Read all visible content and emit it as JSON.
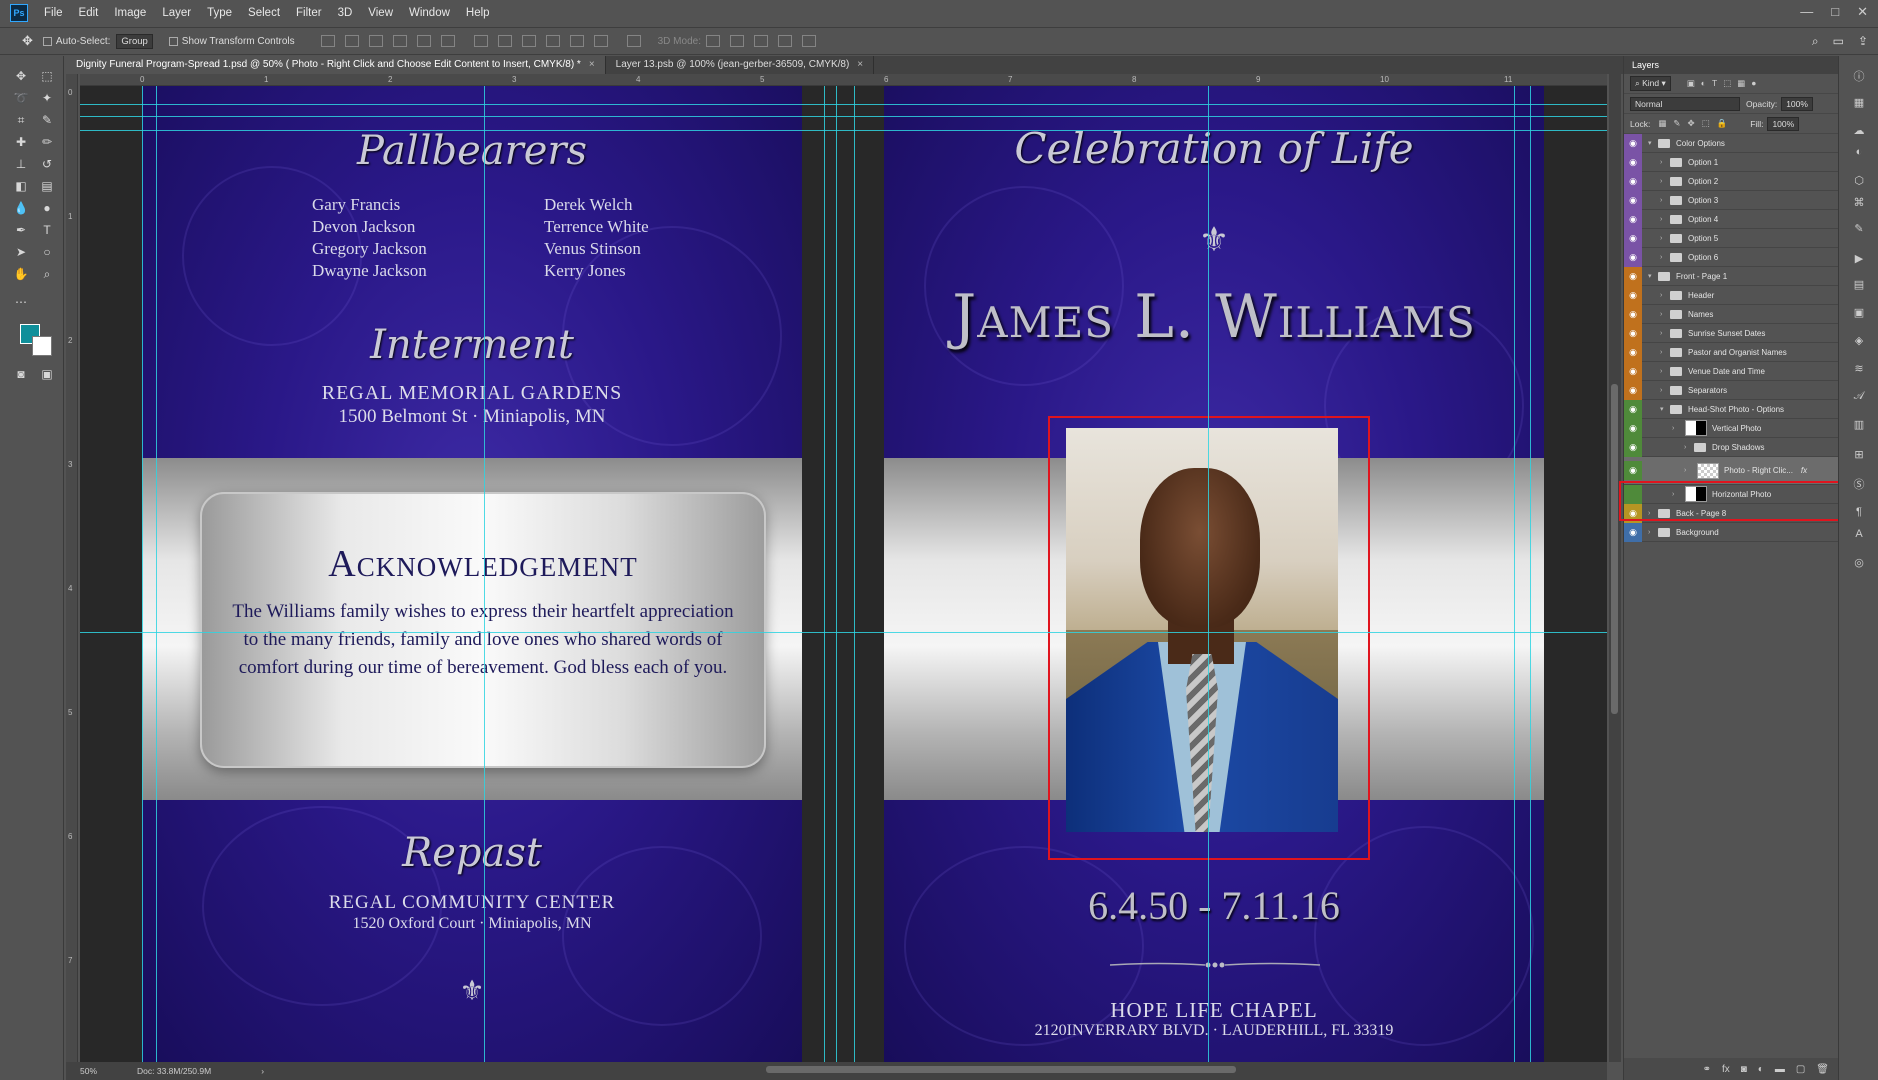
{
  "menu": [
    "File",
    "Edit",
    "Image",
    "Layer",
    "Type",
    "Select",
    "Filter",
    "3D",
    "View",
    "Window",
    "Help"
  ],
  "window_controls": {
    "minimize": "—",
    "maximize": "□",
    "close": "✕"
  },
  "options_bar": {
    "auto_select_label": "Auto-Select:",
    "auto_select_value": "Group",
    "transform_label": "Show Transform Controls",
    "mode_3d": "3D Mode:"
  },
  "tabs": [
    {
      "label": "Dignity Funeral Program-Spread 1.psd @ 50% ( Photo - Right Click and Choose Edit Content to Insert, CMYK/8) *",
      "close": "×"
    },
    {
      "label": "Layer 13.psb @ 100% (jean-gerber-36509, CMYK/8)",
      "close": "×"
    }
  ],
  "ruler_h": [
    "0",
    "1",
    "2",
    "3",
    "4",
    "5",
    "6",
    "7",
    "8",
    "9",
    "10",
    "11"
  ],
  "ruler_v": [
    "0",
    "1",
    "2",
    "3",
    "4",
    "5",
    "6",
    "7"
  ],
  "document": {
    "pallbearers_title": "Pallbearers",
    "pallbearers_col1": [
      "Gary Francis",
      "Devon Jackson",
      "Gregory Jackson",
      "Dwayne Jackson"
    ],
    "pallbearers_col2": [
      "Derek Welch",
      "Terrence White",
      "Venus Stinson",
      "Kerry Jones"
    ],
    "interment_title": "Interment",
    "interment_place": "REGAL MEMORIAL GARDENS",
    "interment_address": "1500 Belmont St · Miniapolis, MN",
    "ack_title": "Acknowledgement",
    "ack_body": "The Williams family wishes to express their heartfelt appreciation to the many friends, family and love ones who shared words of comfort during our time of bereavement.  God bless each of you.",
    "repast_title": "Repast",
    "repast_place": "REGAL COMMUNITY CENTER",
    "repast_address": "1520 Oxford Court · Miniapolis,  MN",
    "celebration_title": "Celebration of Life",
    "deceased_name": "James L. Williams",
    "dates": "6.4.50 - 7.11.16",
    "venue_name": "HOPE LIFE CHAPEL",
    "venue_address": "2120INVERRARY BLVD. · LAUDERHILL, FL 33319"
  },
  "status": {
    "zoom": "50%",
    "doc": "Doc: 33.8M/250.9M"
  },
  "layers_panel": {
    "tab": "Layers",
    "kind_label": "Kind",
    "blend_mode": "Normal",
    "opacity_label": "Opacity:",
    "opacity_value": "100%",
    "lock_label": "Lock:",
    "fill_label": "Fill:",
    "fill_value": "100%",
    "layers": [
      {
        "name": "Color Options",
        "color": "purple",
        "indent": 0,
        "type": "group",
        "open": true
      },
      {
        "name": "Option 1",
        "color": "purple",
        "indent": 1,
        "type": "group"
      },
      {
        "name": "Option 2",
        "color": "purple",
        "indent": 1,
        "type": "group"
      },
      {
        "name": "Option 3",
        "color": "purple",
        "indent": 1,
        "type": "group"
      },
      {
        "name": "Option 4",
        "color": "purple",
        "indent": 1,
        "type": "group"
      },
      {
        "name": "Option 5",
        "color": "purple",
        "indent": 1,
        "type": "group"
      },
      {
        "name": "Option 6",
        "color": "purple",
        "indent": 1,
        "type": "group"
      },
      {
        "name": "Front - Page 1",
        "color": "orange",
        "indent": 0,
        "type": "group",
        "open": true
      },
      {
        "name": "Header",
        "color": "orange",
        "indent": 1,
        "type": "group"
      },
      {
        "name": "Names",
        "color": "orange",
        "indent": 1,
        "type": "group"
      },
      {
        "name": "Sunrise Sunset Dates",
        "color": "orange",
        "indent": 1,
        "type": "group"
      },
      {
        "name": "Pastor and Organist Names",
        "color": "orange",
        "indent": 1,
        "type": "group"
      },
      {
        "name": "Venue Date and Time",
        "color": "orange",
        "indent": 1,
        "type": "group"
      },
      {
        "name": "Separators",
        "color": "orange",
        "indent": 1,
        "type": "group"
      },
      {
        "name": "Head-Shot Photo - Options",
        "color": "green",
        "indent": 1,
        "type": "group",
        "open": true
      },
      {
        "name": "Vertical Photo",
        "color": "green",
        "indent": 2,
        "type": "mask"
      },
      {
        "name": "Drop Shadows",
        "color": "green",
        "indent": 3,
        "type": "group"
      },
      {
        "name": "Photo - Right Clic...",
        "color": "green",
        "indent": 3,
        "type": "smart",
        "selected": true,
        "fx": "fx"
      },
      {
        "name": "Horizontal Photo",
        "color": "green",
        "indent": 2,
        "type": "mask",
        "hidden": true
      },
      {
        "name": "Back - Page 8",
        "color": "yellow",
        "indent": 0,
        "type": "group"
      },
      {
        "name": "Background",
        "color": "blue",
        "indent": 0,
        "type": "group"
      }
    ]
  },
  "colors": {
    "foreground": "#0f8f9a",
    "background": "#ffffff",
    "selection": "#e0141e",
    "guide": "#2fd3e0"
  }
}
